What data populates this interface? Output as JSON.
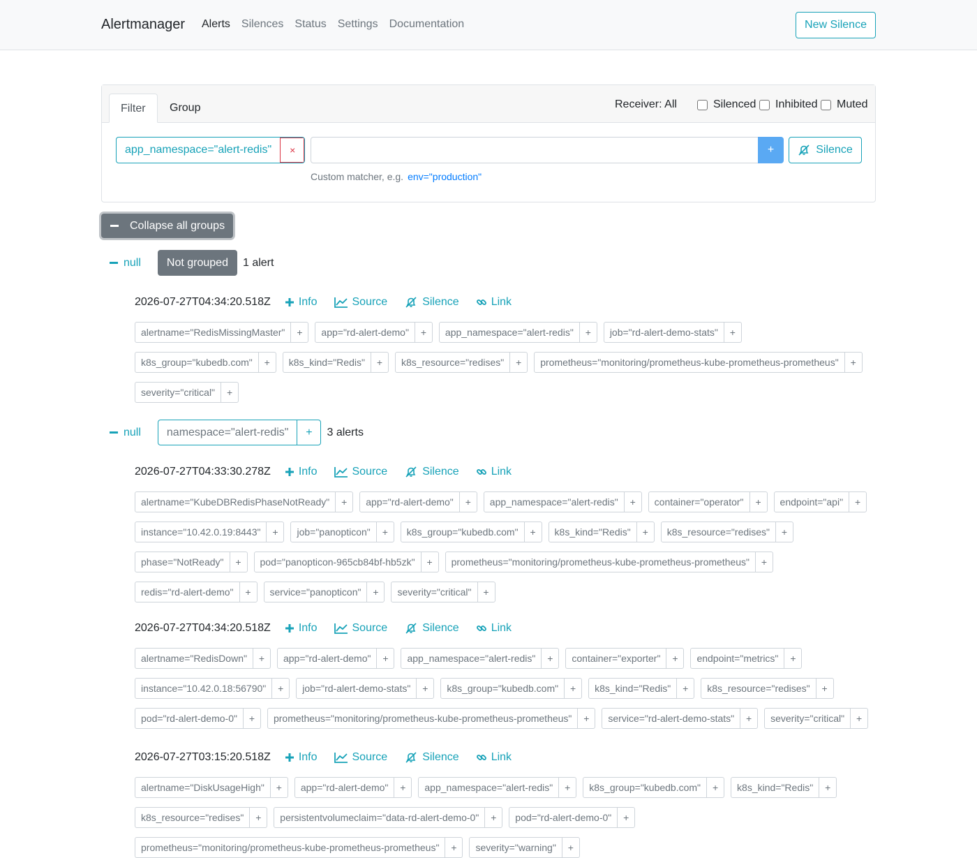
{
  "navbar": {
    "brand": "Alertmanager",
    "links": [
      {
        "label": "Alerts",
        "active": true
      },
      {
        "label": "Silences",
        "active": false
      },
      {
        "label": "Status",
        "active": false
      },
      {
        "label": "Settings",
        "active": false
      },
      {
        "label": "Documentation",
        "active": false
      }
    ],
    "new_silence": "New Silence"
  },
  "filter": {
    "tabs": [
      "Filter",
      "Group"
    ],
    "receiver": "Receiver: All",
    "checkboxes": [
      "Silenced",
      "Inhibited",
      "Muted"
    ],
    "matcher": "app_namespace=\"alert-redis\"",
    "remove_icon": "×",
    "input_value": "",
    "add_label": "+",
    "silence_label": "Silence",
    "hint": "Custom matcher, e.g.",
    "hint_example": "env=\"production\""
  },
  "collapse_all": "Collapse all groups",
  "action_labels": {
    "info": "Info",
    "source": "Source",
    "silence": "Silence",
    "link": "Link"
  },
  "groups": [
    {
      "collapse_label": "null",
      "badge": "Not grouped",
      "count": "1 alert",
      "alerts": [
        {
          "timestamp": "2026-07-27T04:34:20.518Z",
          "labels": [
            "alertname=\"RedisMissingMaster\"",
            "app=\"rd-alert-demo\"",
            "app_namespace=\"alert-redis\"",
            "job=\"rd-alert-demo-stats\"",
            "k8s_group=\"kubedb.com\"",
            "k8s_kind=\"Redis\"",
            "k8s_resource=\"redises\"",
            "prometheus=\"monitoring/prometheus-kube-prometheus-prometheus\"",
            "severity=\"critical\""
          ]
        }
      ]
    },
    {
      "collapse_label": "null",
      "group_label": "namespace=\"alert-redis\"",
      "count": "3 alerts",
      "alerts": [
        {
          "timestamp": "2026-07-27T04:33:30.278Z",
          "labels": [
            "alertname=\"KubeDBRedisPhaseNotReady\"",
            "app=\"rd-alert-demo\"",
            "app_namespace=\"alert-redis\"",
            "container=\"operator\"",
            "endpoint=\"api\"",
            "instance=\"10.42.0.19:8443\"",
            "job=\"panopticon\"",
            "k8s_group=\"kubedb.com\"",
            "k8s_kind=\"Redis\"",
            "k8s_resource=\"redises\"",
            "phase=\"NotReady\"",
            "pod=\"panopticon-965cb84bf-hb5zk\"",
            "prometheus=\"monitoring/prometheus-kube-prometheus-prometheus\"",
            "redis=\"rd-alert-demo\"",
            "service=\"panopticon\"",
            "severity=\"critical\""
          ]
        },
        {
          "timestamp": "2026-07-27T04:34:20.518Z",
          "labels": [
            "alertname=\"RedisDown\"",
            "app=\"rd-alert-demo\"",
            "app_namespace=\"alert-redis\"",
            "container=\"exporter\"",
            "endpoint=\"metrics\"",
            "instance=\"10.42.0.18:56790\"",
            "job=\"rd-alert-demo-stats\"",
            "k8s_group=\"kubedb.com\"",
            "k8s_kind=\"Redis\"",
            "k8s_resource=\"redises\"",
            "pod=\"rd-alert-demo-0\"",
            "prometheus=\"monitoring/prometheus-kube-prometheus-prometheus\"",
            "service=\"rd-alert-demo-stats\"",
            "severity=\"critical\""
          ]
        },
        {
          "timestamp": "2026-07-27T03:15:20.518Z",
          "labels": [
            "alertname=\"DiskUsageHigh\"",
            "app=\"rd-alert-demo\"",
            "app_namespace=\"alert-redis\"",
            "k8s_group=\"kubedb.com\"",
            "k8s_kind=\"Redis\"",
            "k8s_resource=\"redises\"",
            "persistentvolumeclaim=\"data-rd-alert-demo-0\"",
            "pod=\"rd-alert-demo-0\"",
            "prometheus=\"monitoring/prometheus-kube-prometheus-prometheus\"",
            "severity=\"warning\""
          ]
        }
      ]
    }
  ],
  "colors": {
    "accent": "#17a2b8",
    "danger": "#dc3545",
    "primary": "#5aa9f3",
    "secondary": "#6c757d"
  }
}
